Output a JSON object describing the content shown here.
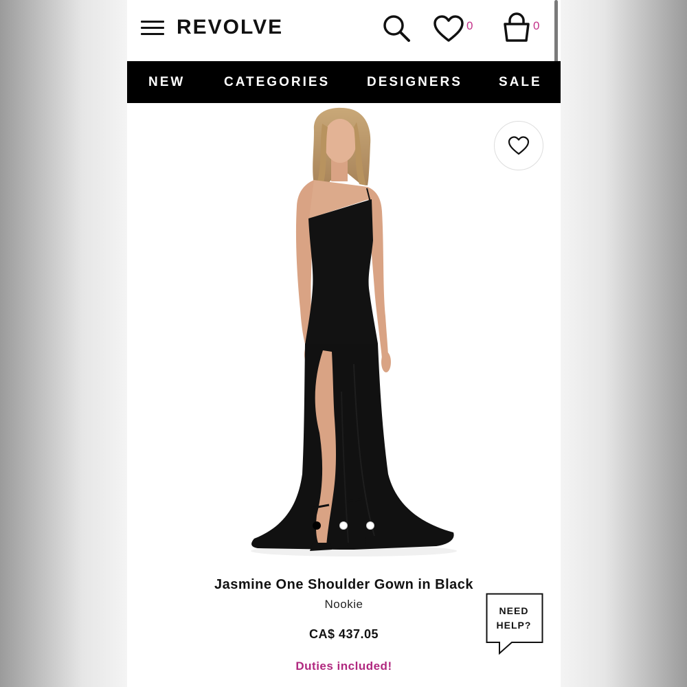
{
  "header": {
    "logo": "REVOLVE",
    "icons": [
      "menu-icon",
      "search-icon",
      "heart-icon",
      "shopping-bag-icon"
    ],
    "wishlist_count": "0",
    "cart_count": "0"
  },
  "nav": {
    "items": [
      "NEW",
      "CATEGORIES",
      "DESIGNERS",
      "SALE"
    ]
  },
  "product": {
    "title": "Jasmine One Shoulder Gown in Black",
    "brand": "Nookie",
    "price": "CA$ 437.05",
    "duties_note": "Duties included!",
    "image_count": 3,
    "active_image": 1
  },
  "help_button": {
    "line1": "NEED",
    "line2": "HELP?"
  },
  "colors": {
    "accent": "#c4328a",
    "nav_bg": "#000000",
    "text": "#111111"
  }
}
